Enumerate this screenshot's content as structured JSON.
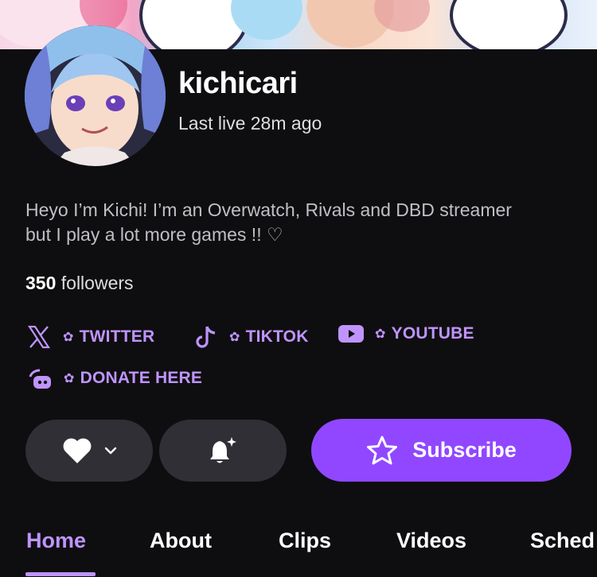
{
  "channel": {
    "name": "kichicari",
    "last_live": "Last live 28m ago",
    "bio": "Heyo I’m Kichi! I’m an Overwatch, Rivals and DBD streamer but I play a lot more games !! ♡",
    "followers_count": "350",
    "followers_label": "followers"
  },
  "socials": [
    {
      "label": "TWITTER",
      "icon": "x-icon"
    },
    {
      "label": "TIKTOK",
      "icon": "tiktok-icon"
    },
    {
      "label": "YOUTUBE",
      "icon": "youtube-icon"
    },
    {
      "label": "DONATE HERE",
      "icon": "streamelements-icon"
    }
  ],
  "actions": {
    "follow_icon": "heart-icon",
    "notify_icon": "bell-sparkle-icon",
    "subscribe_label": "Subscribe"
  },
  "tabs": [
    {
      "label": "Home",
      "active": true
    },
    {
      "label": "About"
    },
    {
      "label": "Clips"
    },
    {
      "label": "Videos"
    },
    {
      "label": "Sched"
    }
  ],
  "colors": {
    "background": "#0e0e10",
    "accent": "#9147ff",
    "accent_text": "#bf94ff",
    "button_dark": "#2f2f35"
  }
}
